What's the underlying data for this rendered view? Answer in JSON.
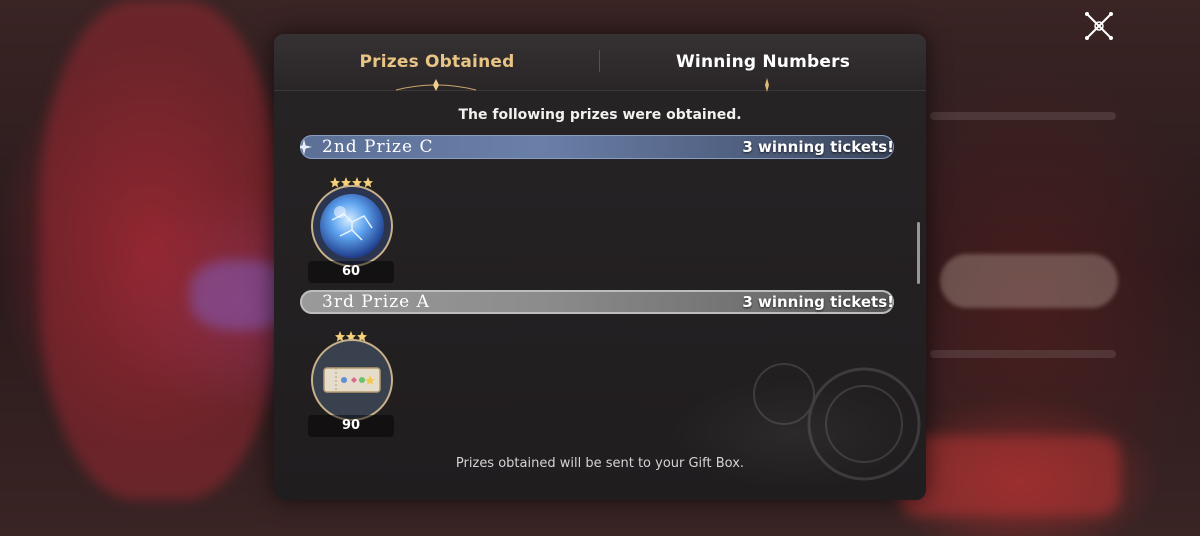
{
  "tabs": [
    {
      "label": "Prizes Obtained",
      "active": true
    },
    {
      "label": "Winning Numbers",
      "active": false
    }
  ],
  "subtitle": "The following prizes were obtained.",
  "prizes": [
    {
      "name": "2nd Prize C",
      "count_text": "3 winning tickets!",
      "item": {
        "icon": "crystal-orb-icon",
        "quantity": "60",
        "stars": 4
      }
    },
    {
      "name": "3rd Prize A",
      "count_text": "3 winning tickets!",
      "item": {
        "icon": "ticket-icon",
        "quantity": "90",
        "stars": 3
      }
    }
  ],
  "footer": "Prizes obtained will be sent to your Gift Box.",
  "colors": {
    "active_tab": "#e8c585",
    "tier2_banner": "#6a7fa8",
    "tier3_banner": "#8c8c8c",
    "star": "#f5d27a"
  }
}
